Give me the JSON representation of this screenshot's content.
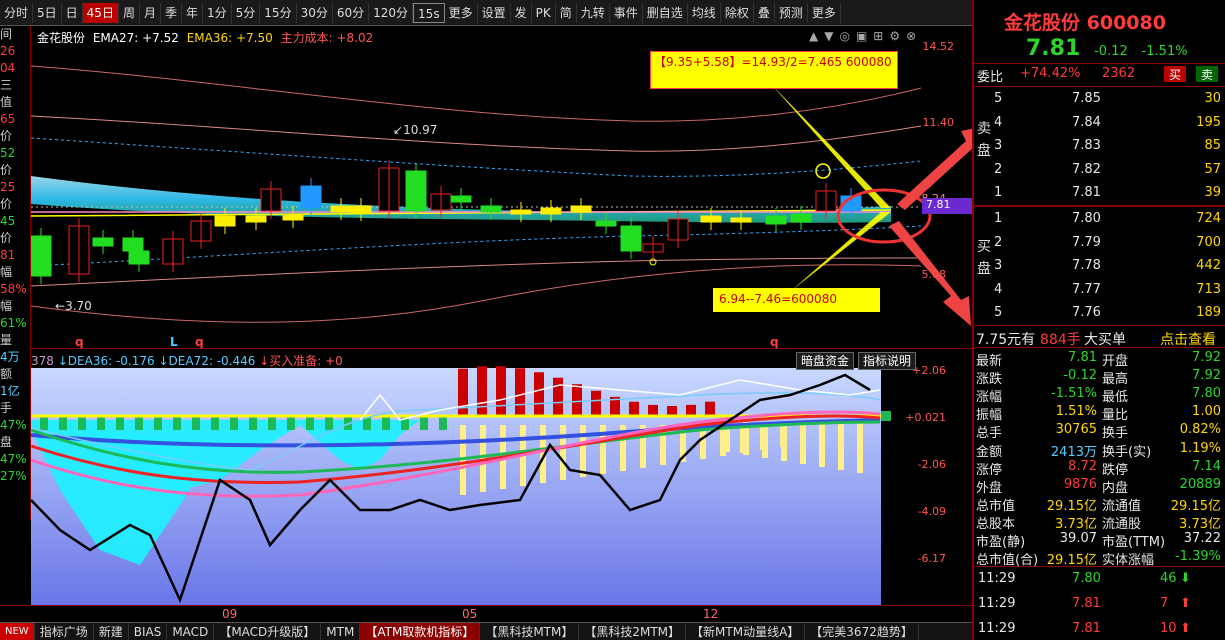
{
  "toolbar": {
    "items": [
      "分时",
      "5日",
      "日",
      "45日",
      "周",
      "月",
      "季",
      "年",
      "1分",
      "5分",
      "15分",
      "30分",
      "60分",
      "120分",
      "15s",
      "更多",
      "设置",
      "发",
      "PK",
      "简",
      "九转",
      "事件",
      "删自选",
      "均线",
      "除权",
      "叠",
      "预测",
      "更多"
    ],
    "active_index": 3,
    "selected_index": 14
  },
  "stock": {
    "name": "金花股份",
    "code": "600080",
    "price": "7.81",
    "change": "-0.12",
    "pct": "-1.51%"
  },
  "legend": {
    "name": "金花股份",
    "ema27": "EMA27: +7.52",
    "ema36": "EMA36: +7.50",
    "cost": "主力成本: +8.02"
  },
  "left_strip": {
    "items": [
      {
        "t": "间",
        "c": "w"
      },
      {
        "t": "26",
        "c": "r"
      },
      {
        "t": "04",
        "c": "r"
      },
      {
        "t": "三",
        "c": "w"
      },
      {
        "t": "值",
        "c": "w"
      },
      {
        "t": "65",
        "c": "r"
      },
      {
        "t": "价",
        "c": "w"
      },
      {
        "t": "52",
        "c": "g"
      },
      {
        "t": "价",
        "c": "w"
      },
      {
        "t": "25",
        "c": "r"
      },
      {
        "t": "价",
        "c": "w"
      },
      {
        "t": "45",
        "c": "g"
      },
      {
        "t": "价",
        "c": "w"
      },
      {
        "t": "81",
        "c": "r"
      },
      {
        "t": "幅",
        "c": "w"
      },
      {
        "t": "58%",
        "c": "r"
      },
      {
        "t": "幅",
        "c": "w"
      },
      {
        "t": "61%",
        "c": "g"
      },
      {
        "t": "量",
        "c": "w"
      },
      {
        "t": "4万",
        "c": "c"
      },
      {
        "t": "额",
        "c": "w"
      },
      {
        "t": "1亿",
        "c": "c"
      },
      {
        "t": "手",
        "c": "w"
      },
      {
        "t": "47%",
        "c": "g"
      },
      {
        "t": "盘",
        "c": "w"
      },
      {
        "t": "47%",
        "c": "g"
      },
      {
        "t": "27%",
        "c": "g"
      }
    ]
  },
  "price_axis": [
    "14.52",
    "11.40",
    "8.24",
    "7.81",
    "5.08"
  ],
  "annotations": {
    "high": "10.97",
    "low": "3.70",
    "top_box": "【9.35+5.58】=14.93/2=7.465 600080",
    "bottom_box": "6.94--7.46=600080",
    "markers": [
      "q",
      "L",
      "q",
      "q"
    ]
  },
  "indicator": {
    "head_prefix": "378",
    "dea36": "DEA36: -0.176",
    "dea72": "DEA72: -0.446",
    "buy_prep": "买入准备: +0",
    "btn_dark": "暗盘资金",
    "btn_desc": "指标说明",
    "axis": [
      "+2.06",
      "+0.021",
      "-2.06",
      "-4.09",
      "-6.17"
    ]
  },
  "x_axis": [
    "09",
    "05",
    "12"
  ],
  "bottom_tabs": [
    "NEW",
    "指标广场",
    "新建",
    "BIAS",
    "MACD",
    "【MACD升级版】",
    "MTM",
    "【ATM取款机指标】",
    "【黑科技MTM】",
    "【黑科技2MTM】",
    "【新MTM动量线A】",
    "【完美3672趋势】"
  ],
  "bottom_active": 7,
  "right": {
    "wb_label": "委比",
    "wb_value": "+74.42%",
    "wc_value": "2362",
    "buy_btn": "买",
    "sell_btn": "卖",
    "sell_label": "卖盘",
    "buy_label": "买盘",
    "asks": [
      {
        "lvl": "5",
        "price": "7.85",
        "vol": "30"
      },
      {
        "lvl": "4",
        "price": "7.84",
        "vol": "195"
      },
      {
        "lvl": "3",
        "price": "7.83",
        "vol": "85"
      },
      {
        "lvl": "2",
        "price": "7.82",
        "vol": "57"
      },
      {
        "lvl": "1",
        "price": "7.81",
        "vol": "39"
      }
    ],
    "bids": [
      {
        "lvl": "1",
        "price": "7.80",
        "vol": "724"
      },
      {
        "lvl": "2",
        "price": "7.79",
        "vol": "700"
      },
      {
        "lvl": "3",
        "price": "7.78",
        "vol": "442"
      },
      {
        "lvl": "4",
        "price": "7.77",
        "vol": "713"
      },
      {
        "lvl": "5",
        "price": "7.76",
        "vol": "189"
      }
    ],
    "big": {
      "price": "7.75元有",
      "vol": "884手",
      "label": "大买单",
      "link": "点击查看"
    },
    "quote": [
      {
        "k1": "最新",
        "v1": "7.81",
        "c1": "g",
        "k2": "开盘",
        "v2": "7.92",
        "c2": "g"
      },
      {
        "k1": "涨跌",
        "v1": "-0.12",
        "c1": "g",
        "k2": "最高",
        "v2": "7.92",
        "c2": "g"
      },
      {
        "k1": "涨幅",
        "v1": "-1.51%",
        "c1": "g",
        "k2": "最低",
        "v2": "7.80",
        "c2": "g"
      },
      {
        "k1": "振幅",
        "v1": "1.51%",
        "c1": "y",
        "k2": "量比",
        "v2": "1.00",
        "c2": "y"
      },
      {
        "k1": "总手",
        "v1": "30765",
        "c1": "y",
        "k2": "换手",
        "v2": "0.82%",
        "c2": "y"
      },
      {
        "k1": "金额",
        "v1": "2413万",
        "c1": "c",
        "k2": "换手(实)",
        "v2": "1.19%",
        "c2": "y"
      },
      {
        "k1": "涨停",
        "v1": "8.72",
        "c1": "r",
        "k2": "跌停",
        "v2": "7.14",
        "c2": "g"
      },
      {
        "k1": "外盘",
        "v1": "9876",
        "c1": "r",
        "k2": "内盘",
        "v2": "20889",
        "c2": "g"
      },
      {
        "k1": "总市值",
        "v1": "29.15亿",
        "c1": "y",
        "k2": "流通值",
        "v2": "29.15亿",
        "c2": "y"
      },
      {
        "k1": "总股本",
        "v1": "3.73亿",
        "c1": "y",
        "k2": "流通股",
        "v2": "3.73亿",
        "c2": "y"
      },
      {
        "k1": "市盈(静)",
        "v1": "39.07",
        "c1": "w",
        "k2": "市盈(TTM)",
        "v2": "37.22",
        "c2": "w"
      },
      {
        "k1": "总市值(合)",
        "v1": "29.15亿",
        "c1": "y",
        "k2": "实体涨幅",
        "v2": "-1.39%",
        "c2": "g"
      }
    ],
    "ticks": [
      {
        "time": "11:29",
        "price": "7.80",
        "vol": "46",
        "dir": "down"
      },
      {
        "time": "11:29",
        "price": "7.81",
        "vol": "7",
        "dir": "up"
      },
      {
        "time": "11:29",
        "price": "7.81",
        "vol": "10",
        "dir": "up"
      }
    ]
  }
}
